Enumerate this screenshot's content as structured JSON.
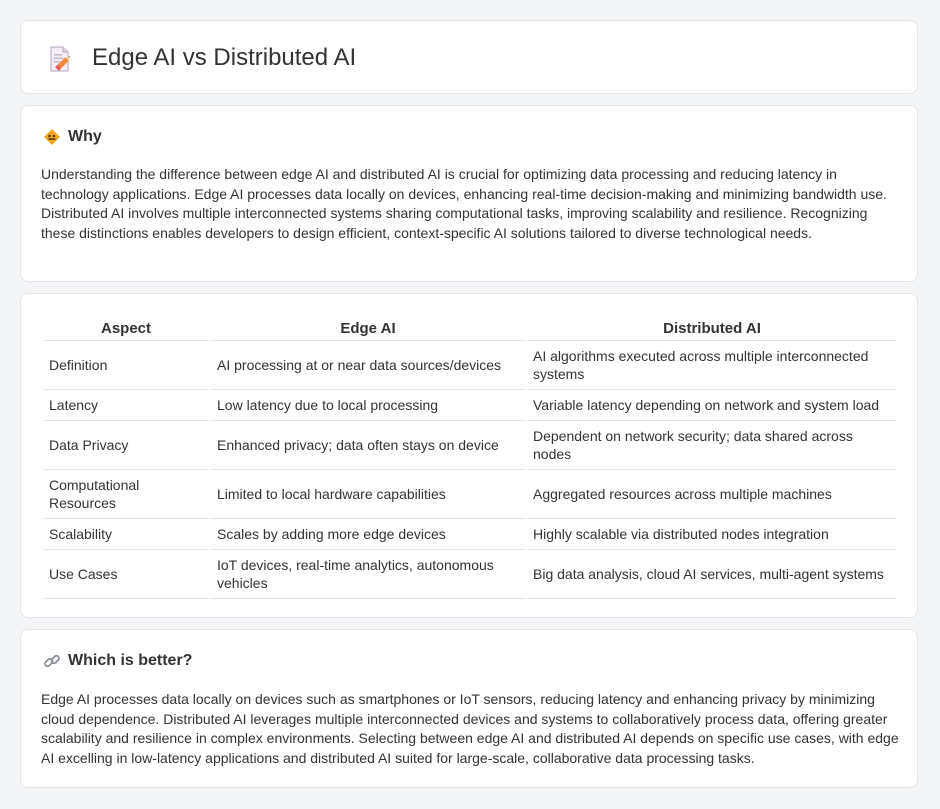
{
  "page": {
    "title": "Edge AI vs Distributed AI"
  },
  "why": {
    "heading": "Why",
    "body": "Understanding the difference between edge AI and distributed AI is crucial for optimizing data processing and reducing latency in technology applications. Edge AI processes data locally on devices, enhancing real-time decision-making and minimizing bandwidth use. Distributed AI involves multiple interconnected systems sharing computational tasks, improving scalability and resilience. Recognizing these distinctions enables developers to design efficient, context-specific AI solutions tailored to diverse technological needs."
  },
  "table": {
    "headers": [
      "Aspect",
      "Edge AI",
      "Distributed AI"
    ],
    "rows": [
      [
        "Definition",
        "AI processing at or near data sources/devices",
        "AI algorithms executed across multiple interconnected systems"
      ],
      [
        "Latency",
        "Low latency due to local processing",
        "Variable latency depending on network and system load"
      ],
      [
        "Data Privacy",
        "Enhanced privacy; data often stays on device",
        "Dependent on network security; data shared across nodes"
      ],
      [
        "Computational Resources",
        "Limited to local hardware capabilities",
        "Aggregated resources across multiple machines"
      ],
      [
        "Scalability",
        "Scales by adding more edge devices",
        "Highly scalable via distributed nodes integration"
      ],
      [
        "Use Cases",
        "IoT devices, real-time analytics, autonomous vehicles",
        "Big data analysis, cloud AI services, multi-agent systems"
      ]
    ]
  },
  "which": {
    "heading": "Which is better?",
    "body": "Edge AI processes data locally on devices such as smartphones or IoT sensors, reducing latency and enhancing privacy by minimizing cloud dependence. Distributed AI leverages multiple interconnected devices and systems to collaboratively process data, offering greater scalability and resilience in complex environments. Selecting between edge AI and distributed AI depends on specific use cases, with edge AI excelling in low-latency applications and distributed AI suited for large-scale, collaborative data processing tasks."
  },
  "icons": {
    "title": "document-pencil-icon",
    "why": "warning-sign-icon",
    "which": "link-icon"
  },
  "colors": {
    "background": "#f4f5f7",
    "card": "#ffffff",
    "border": "#e3e5e8",
    "text": "#333333"
  }
}
